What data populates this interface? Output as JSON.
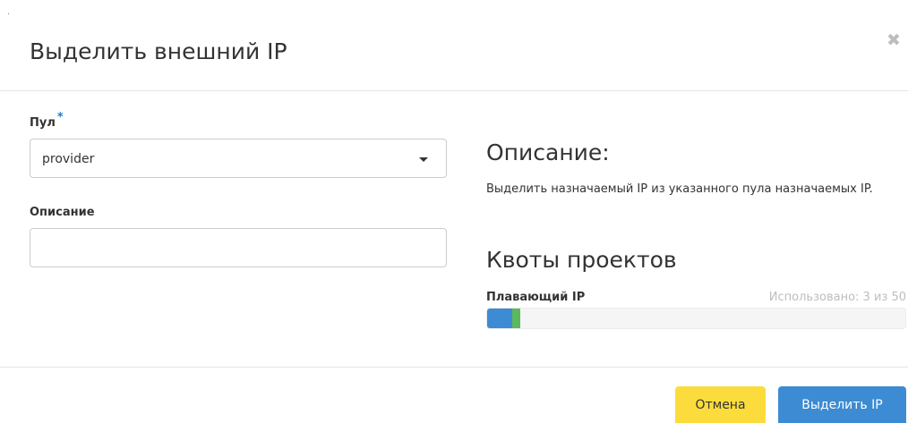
{
  "dialog": {
    "title": "Выделить внешний IP",
    "close_icon": "close-icon"
  },
  "form": {
    "pool": {
      "label": "Пул",
      "required_mark": "*",
      "selected": "provider"
    },
    "description": {
      "label": "Описание",
      "value": "",
      "placeholder": ""
    }
  },
  "help": {
    "heading": "Описание:",
    "text": "Выделить назначаемый IP из указанного пула назначаемых IP."
  },
  "quotas": {
    "heading": "Квоты проектов",
    "item_label": "Плавающий IP",
    "usage_text": "Использовано: 3 из 50",
    "used": 3,
    "adding": 1,
    "total": 50
  },
  "footer": {
    "cancel_label": "Отмена",
    "submit_label": "Выделить IP"
  },
  "colors": {
    "accent": "#3d8bd2",
    "cancel": "#fbdc3c",
    "progress_new": "#5cb85c",
    "required": "#1f7fd0"
  }
}
